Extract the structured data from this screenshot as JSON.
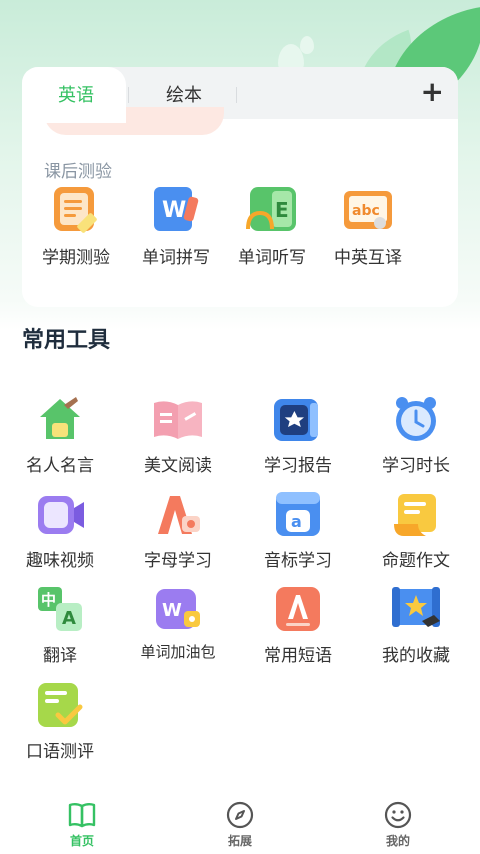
{
  "tabs": [
    {
      "label": "英语",
      "active": true
    },
    {
      "label": "绘本",
      "active": false
    }
  ],
  "add_icon": "plus-icon",
  "section_label": "课后测验",
  "quiz_items": [
    {
      "label": "学期测验",
      "icon": "term-quiz-icon"
    },
    {
      "label": "单词拼写",
      "icon": "word-spelling-icon"
    },
    {
      "label": "单词听写",
      "icon": "word-dictation-icon"
    },
    {
      "label": "中英互译",
      "icon": "translation-abc-icon"
    }
  ],
  "tools_title": "常用工具",
  "tools": [
    {
      "label": "名人名言",
      "icon": "quote-house-icon"
    },
    {
      "label": "美文阅读",
      "icon": "open-book-icon"
    },
    {
      "label": "学习报告",
      "icon": "report-icon"
    },
    {
      "label": "学习时长",
      "icon": "alarm-clock-icon"
    },
    {
      "label": "趣味视频",
      "icon": "video-camera-icon"
    },
    {
      "label": "字母学习",
      "icon": "letter-a-icon"
    },
    {
      "label": "音标学习",
      "icon": "phonetic-book-icon"
    },
    {
      "label": "命题作文",
      "icon": "scroll-icon"
    },
    {
      "label": "翻译",
      "icon": "translate-icon"
    },
    {
      "label": "单词加油包",
      "icon": "word-pack-icon"
    },
    {
      "label": "常用短语",
      "icon": "phrase-a-icon"
    },
    {
      "label": "我的收藏",
      "icon": "star-scroll-icon"
    },
    {
      "label": "口语测评",
      "icon": "speaking-check-icon"
    }
  ],
  "nav": [
    {
      "label": "首页",
      "icon": "book-icon",
      "active": true
    },
    {
      "label": "拓展",
      "icon": "compass-icon",
      "active": false
    },
    {
      "label": "我的",
      "icon": "smiley-icon",
      "active": false
    }
  ],
  "colors": {
    "accent": "#35c163",
    "title": "#1f2d3d",
    "muted": "#8a96a3"
  }
}
